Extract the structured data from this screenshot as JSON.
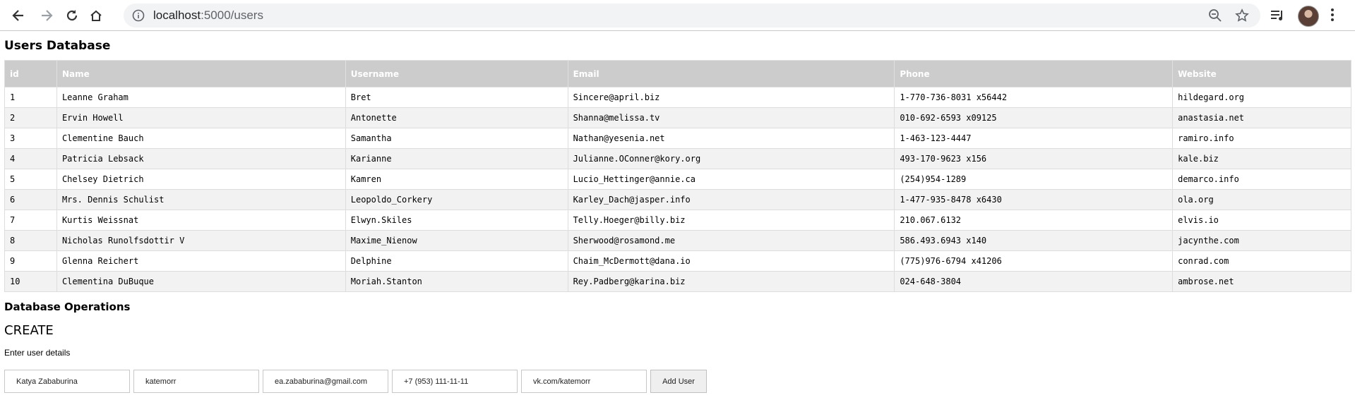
{
  "browser": {
    "url_host": "localhost",
    "url_path": ":5000/users"
  },
  "page": {
    "title": "Users Database",
    "ops_title": "Database Operations",
    "create_title": "CREATE",
    "create_hint": "Enter user details"
  },
  "table": {
    "columns": [
      "id",
      "Name",
      "Username",
      "Email",
      "Phone",
      "Website"
    ],
    "rows": [
      [
        "1",
        "Leanne Graham",
        "Bret",
        "Sincere@april.biz",
        "1-770-736-8031 x56442",
        "hildegard.org"
      ],
      [
        "2",
        "Ervin Howell",
        "Antonette",
        "Shanna@melissa.tv",
        "010-692-6593 x09125",
        "anastasia.net"
      ],
      [
        "3",
        "Clementine Bauch",
        "Samantha",
        "Nathan@yesenia.net",
        "1-463-123-4447",
        "ramiro.info"
      ],
      [
        "4",
        "Patricia Lebsack",
        "Karianne",
        "Julianne.OConner@kory.org",
        "493-170-9623 x156",
        "kale.biz"
      ],
      [
        "5",
        "Chelsey Dietrich",
        "Kamren",
        "Lucio_Hettinger@annie.ca",
        "(254)954-1289",
        "demarco.info"
      ],
      [
        "6",
        "Mrs. Dennis Schulist",
        "Leopoldo_Corkery",
        "Karley_Dach@jasper.info",
        "1-477-935-8478 x6430",
        "ola.org"
      ],
      [
        "7",
        "Kurtis Weissnat",
        "Elwyn.Skiles",
        "Telly.Hoeger@billy.biz",
        "210.067.6132",
        "elvis.io"
      ],
      [
        "8",
        "Nicholas Runolfsdottir V",
        "Maxime_Nienow",
        "Sherwood@rosamond.me",
        "586.493.6943 x140",
        "jacynthe.com"
      ],
      [
        "9",
        "Glenna Reichert",
        "Delphine",
        "Chaim_McDermott@dana.io",
        "(775)976-6794 x41206",
        "conrad.com"
      ],
      [
        "10",
        "Clementina DuBuque",
        "Moriah.Stanton",
        "Rey.Padberg@karina.biz",
        "024-648-3804",
        "ambrose.net"
      ]
    ]
  },
  "form": {
    "name_value": "Katya Zababurina",
    "username_value": "katemorr",
    "email_value": "ea.zababurina@gmail.com",
    "phone_value": "+7 (953) 111-11-11",
    "website_value": "vk.com/katemorr",
    "submit_label": "Add User"
  }
}
